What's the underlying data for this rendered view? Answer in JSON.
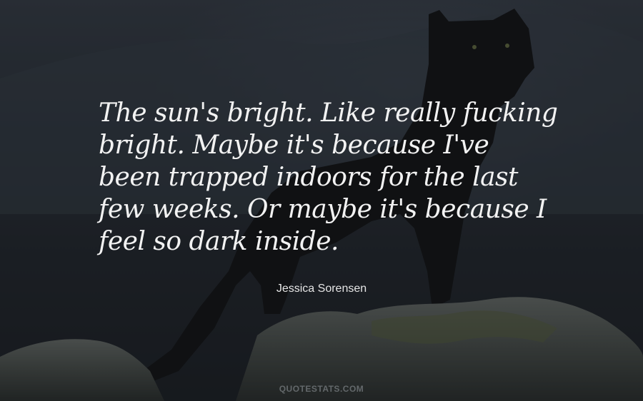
{
  "quote": {
    "lines": [
      "The sun's bright. Like really fucking",
      "bright. Maybe it's because I've",
      "been trapped indoors for the last",
      "few weeks. Or maybe it's because I",
      "feel so dark inside."
    ]
  },
  "author": "Jessica Sorensen",
  "watermark": "QUOTESTATS.COM",
  "colors": {
    "text": "#f2f2f2",
    "background": "#2a2e35"
  }
}
